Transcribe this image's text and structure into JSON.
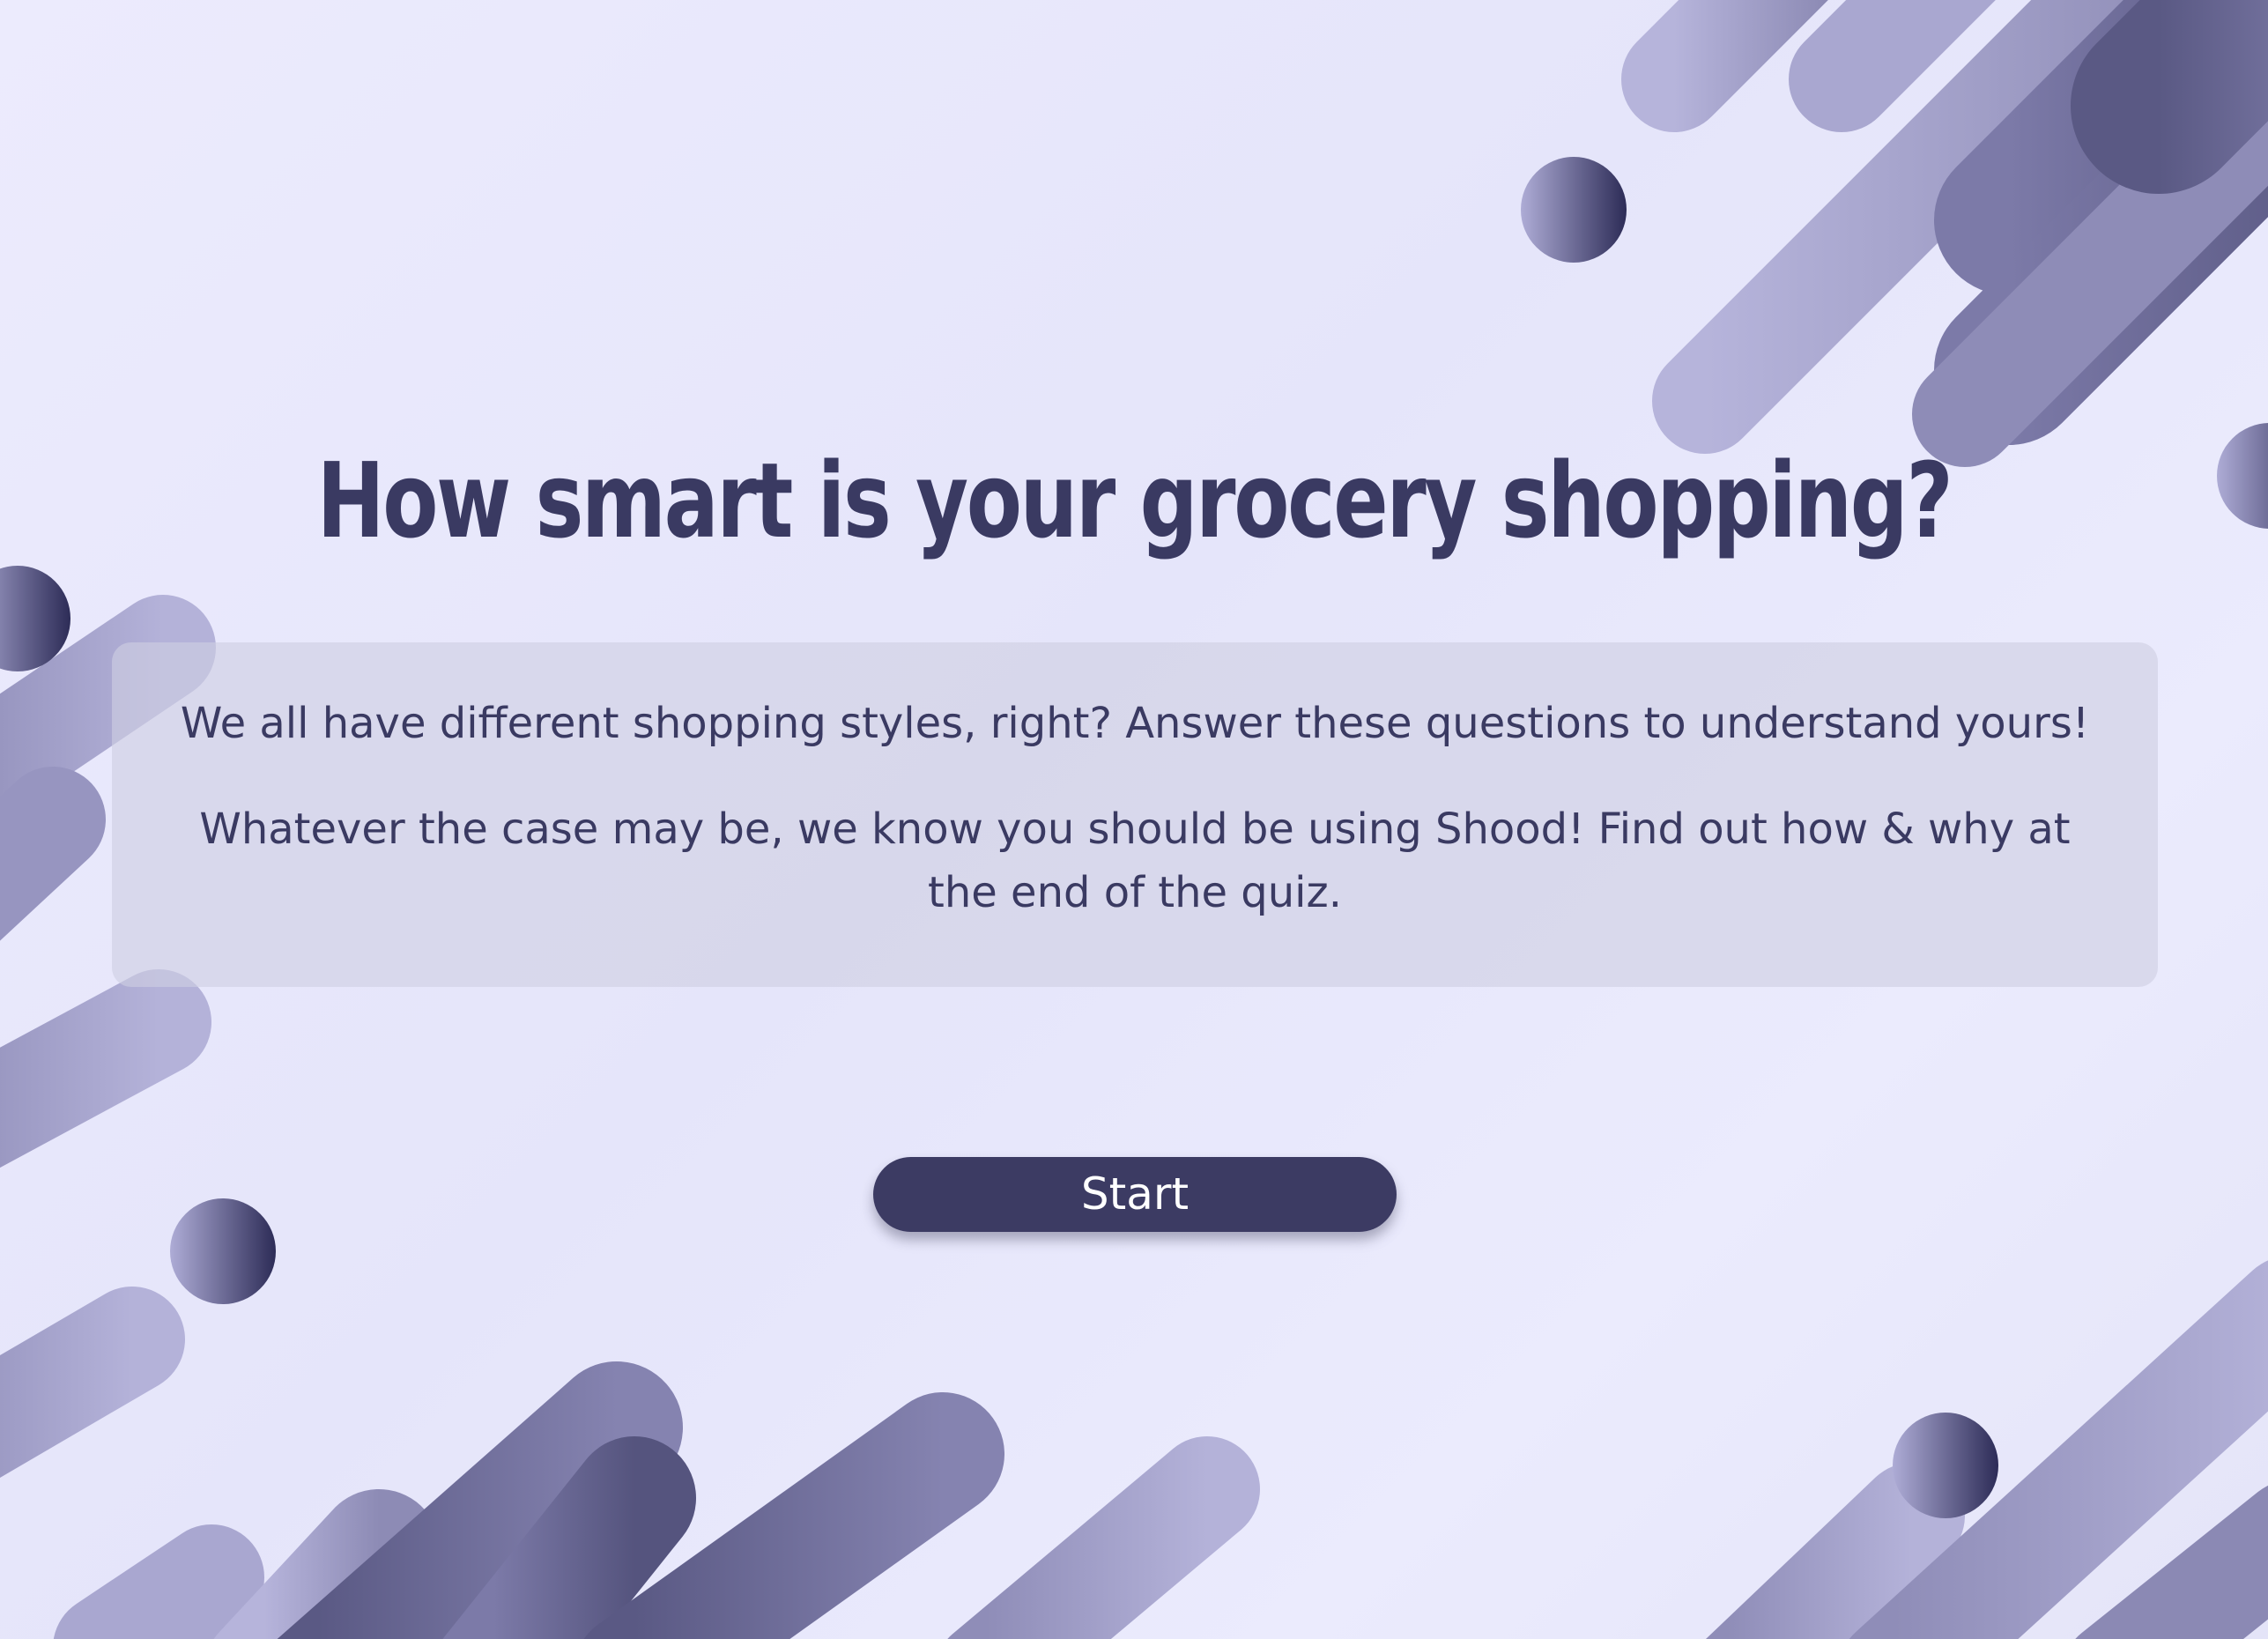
{
  "page": {
    "title": "How smart is your grocery shopping?",
    "intro_line_1": "We all have different shopping styles, right? Answer these questions to understand yours!",
    "intro_line_2": "Whatever the case may be, we know you should be using Shood! Find out how & why at the end of the quiz.",
    "start_label": "Start"
  },
  "colors": {
    "background": "#e9e9fc",
    "text": "#3a3a62",
    "button": "#3c3b63",
    "button_text": "#ffffff",
    "shape_light": "#b3b1d8",
    "shape_dark": "#2c2b55"
  }
}
